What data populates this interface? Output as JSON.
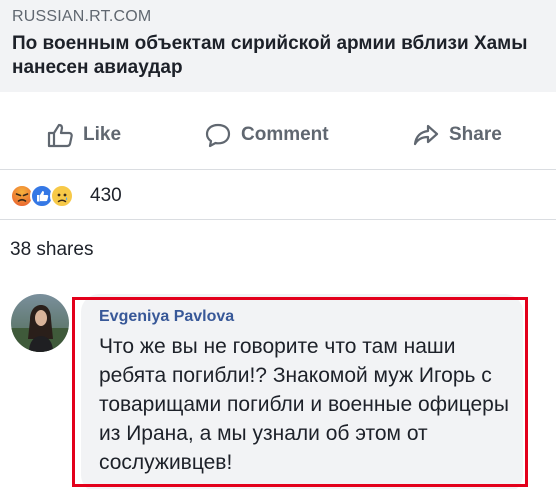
{
  "link_preview": {
    "domain": "RUSSIAN.RT.COM",
    "title": "По военным объектам сирийской армии вблизи Хамы нанесен авиаудар"
  },
  "actions": {
    "like": "Like",
    "comment": "Comment",
    "share": "Share"
  },
  "reactions": {
    "icons": [
      "angry-reaction-icon",
      "like-reaction-icon",
      "sad-reaction-icon"
    ],
    "count": "430"
  },
  "shares": "38 shares",
  "comment": {
    "author": "Evgeniya Pavlova",
    "text": "Что же вы не говорите что там наши ребята погибли!? Знакомой муж Игорь с товарищами погибли и военные офицеры из Ирана, а мы узнали об этом от сослуживцев!"
  },
  "colors": {
    "link_preview_bg": "#f2f3f5",
    "action_text": "#606770",
    "author_name": "#385898",
    "highlight_border": "#e3001b",
    "like_reaction": "#3578e5"
  }
}
